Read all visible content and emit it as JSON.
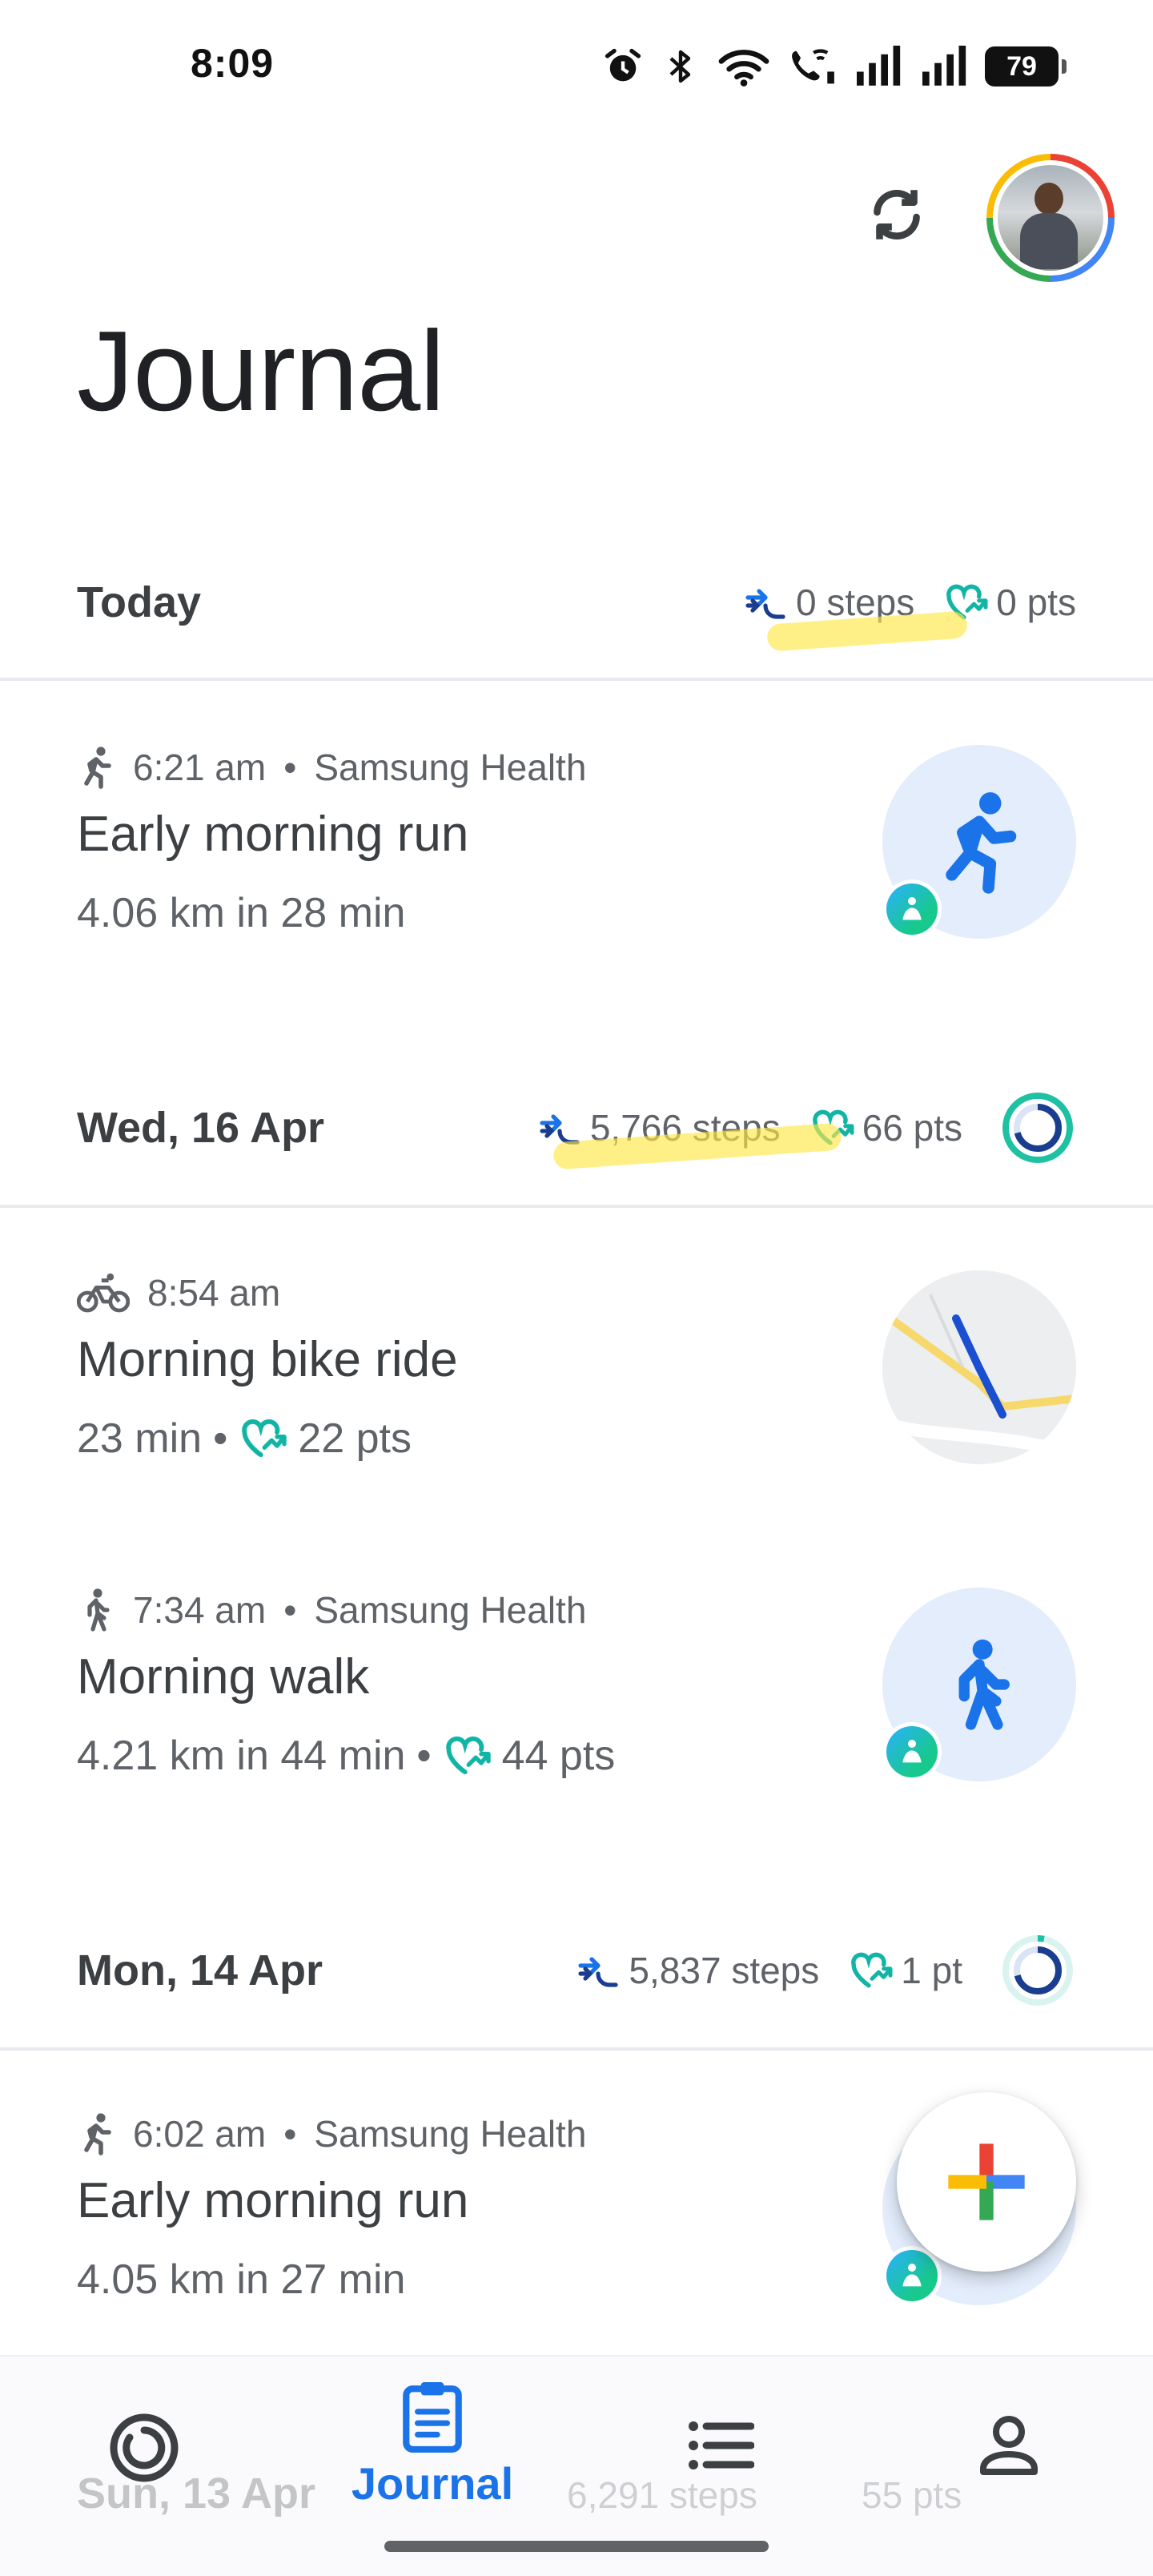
{
  "status_bar": {
    "time": "8:09",
    "battery": "79"
  },
  "header": {
    "title": "Journal"
  },
  "days": [
    {
      "label": "Today",
      "steps": "0 steps",
      "points": "0 pts"
    },
    {
      "label": "Wed, 16 Apr",
      "steps": "5,766 steps",
      "points": "66 pts"
    },
    {
      "label": "Mon, 14 Apr",
      "steps": "5,837 steps",
      "points": "1 pt"
    },
    {
      "label": "Sun, 13 Apr",
      "steps": "6,291 steps",
      "points": "55 pts"
    }
  ],
  "activities": [
    {
      "time": "6:21 am",
      "source": "Samsung Health",
      "title": "Early morning run",
      "detail": "4.06 km in 28 min"
    },
    {
      "time": "8:54 am",
      "title": "Morning bike ride",
      "detail": "23 min",
      "points": "22 pts"
    },
    {
      "time": "7:34 am",
      "source": "Samsung Health",
      "title": "Morning walk",
      "detail": "4.21 km in 44 min",
      "points": "44 pts"
    },
    {
      "time": "6:02 am",
      "source": "Samsung Health",
      "title": "Early morning run",
      "detail": "4.05 km in 27 min"
    }
  ],
  "separator": "•",
  "bottom_nav": {
    "active_label": "Journal"
  },
  "colors": {
    "accent_blue": "#1a73e8",
    "heart_teal": "#12b5a5",
    "ring_teal": "#1ec2a3",
    "ring_navy": "#1a3d8f"
  }
}
